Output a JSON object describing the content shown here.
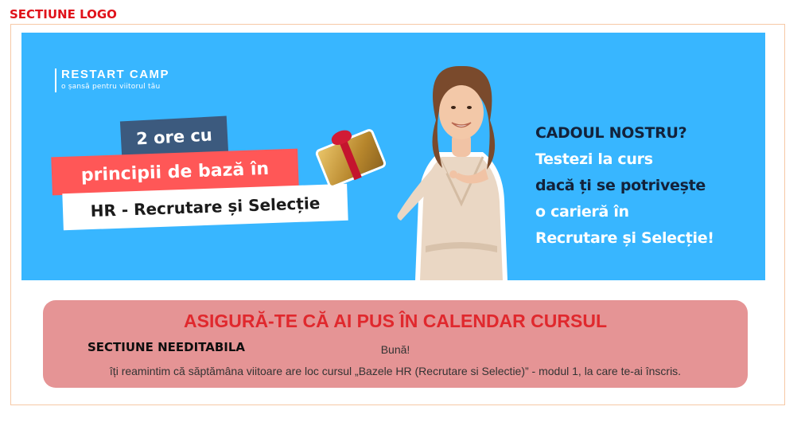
{
  "section_label": "SECTIUNE LOGO",
  "banner": {
    "logo_name": "RESTART CAMP",
    "logo_tagline": "o șansă pentru viitorul tău",
    "tag_line1": "2 ore cu",
    "tag_line2": "principii de bază în",
    "tag_line3": "HR - Recrutare și Selecție",
    "cta_heading": "CADOUL NOSTRU?",
    "cta_line1": "Testezi la curs",
    "cta_line2": "dacă ți se potrivește",
    "cta_line3": "o carieră în",
    "cta_line4": "Recrutare și Selecție!",
    "background_color": "#38b6ff"
  },
  "reminder": {
    "title": "ASIGURĂ-TE CĂ AI PUS ÎN CALENDAR CURSUL",
    "badge": "SECTIUNE NEEDITABILA",
    "greeting": "Bună!",
    "body": "îți reamintim că săptămâna viitoare are loc cursul „Bazele HR (Recrutare si Selectie)” - modul 1, la care te-ai înscris.",
    "background_color": "#e59495"
  }
}
